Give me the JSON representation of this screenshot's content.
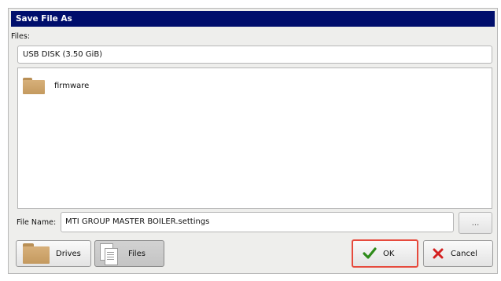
{
  "dialog": {
    "title": "Save File As",
    "files_label": "Files:",
    "drive": "USB DISK (3.50 GiB)",
    "items": [
      {
        "name": "firmware",
        "icon": "folder-icon"
      }
    ],
    "file_name_label": "File Name:",
    "file_name_value": "MTI GROUP MASTER BOILER.settings",
    "browse_label": "..."
  },
  "buttons": {
    "drives": "Drives",
    "files": "Files",
    "ok": "OK",
    "cancel": "Cancel"
  },
  "colors": {
    "title_bar": "#000e6c",
    "ok_highlight": "#e64a3d",
    "ok_check": "#2e8b1a",
    "cancel_x": "#d42020",
    "folder": "#c9a066"
  }
}
